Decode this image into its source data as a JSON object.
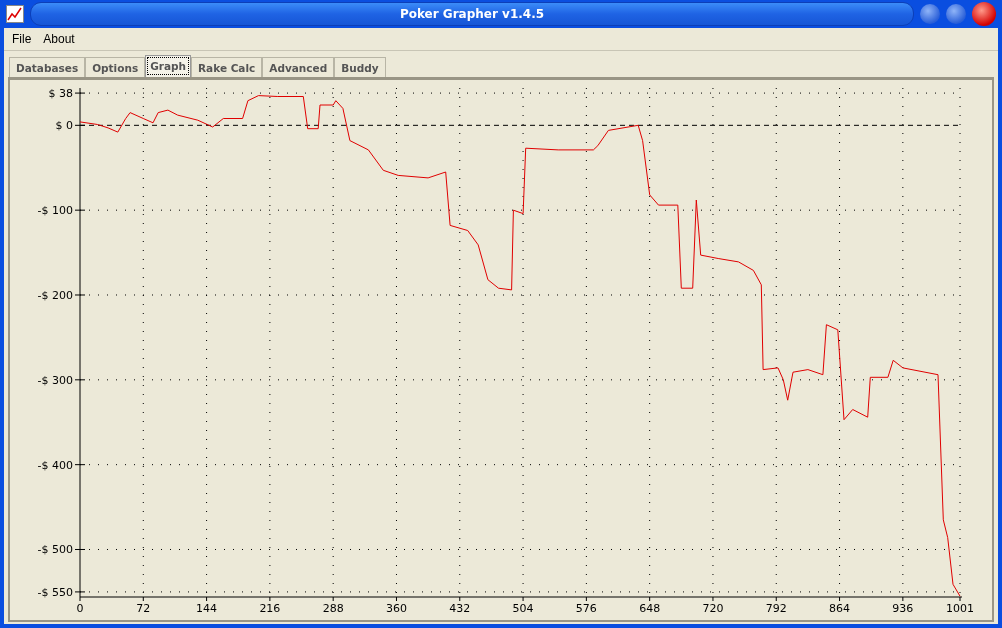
{
  "window": {
    "title": "Poker Grapher v1.4.5"
  },
  "menu": [
    {
      "label": "File"
    },
    {
      "label": "About"
    }
  ],
  "tabs": [
    {
      "label": "Databases",
      "selected": false
    },
    {
      "label": "Options",
      "selected": false
    },
    {
      "label": "Graph",
      "selected": true
    },
    {
      "label": "Rake Calc",
      "selected": false
    },
    {
      "label": "Advanced",
      "selected": false
    },
    {
      "label": "Buddy",
      "selected": false
    }
  ],
  "graph": {
    "chart_data": {
      "type": "line",
      "xlim": [
        0,
        1001
      ],
      "ylim": [
        -556,
        44
      ],
      "xticks": [
        0,
        72,
        144,
        216,
        288,
        360,
        432,
        504,
        576,
        648,
        720,
        792,
        864,
        936,
        1001
      ],
      "yticks": [
        {
          "value": 38,
          "label": "$ 38"
        },
        {
          "value": 0,
          "label": "$ 0"
        },
        {
          "value": -100,
          "label": "-$ 100"
        },
        {
          "value": -200,
          "label": "-$ 200"
        },
        {
          "value": -300,
          "label": "-$ 300"
        },
        {
          "value": -400,
          "label": "-$ 400"
        },
        {
          "value": -500,
          "label": "-$ 500"
        },
        {
          "value": -550,
          "label": "-$ 550"
        }
      ],
      "x": [
        0,
        20,
        32,
        43,
        52,
        57,
        72,
        83,
        89,
        100,
        111,
        134,
        151,
        163,
        185,
        191,
        203,
        225,
        254,
        259,
        271,
        273,
        288,
        291,
        299,
        307,
        328,
        345,
        362,
        396,
        416,
        421,
        441,
        453,
        464,
        476,
        491,
        493,
        504,
        507,
        544,
        584,
        589,
        601,
        635,
        640,
        648,
        658,
        680,
        684,
        697,
        701,
        706,
        726,
        749,
        766,
        775,
        777,
        794,
        800,
        805,
        811,
        828,
        845,
        849,
        862,
        869,
        879,
        896,
        899,
        919,
        925,
        936,
        976,
        982,
        987,
        993,
        1001
      ],
      "grid": true,
      "series": [
        {
          "color": "#e00000",
          "values": [
            4,
            1,
            -3,
            -8,
            8,
            15,
            8,
            3,
            15,
            18,
            12,
            6,
            -2,
            8,
            8,
            29,
            35,
            34,
            34,
            -4,
            -4,
            24,
            24,
            29,
            20,
            -18,
            -29,
            -53,
            -59,
            -62,
            -55,
            -118,
            -124,
            -141,
            -182,
            -192,
            -194,
            -100,
            -104,
            -27,
            -29,
            -29,
            -24,
            -6,
            0,
            -18,
            -82,
            -94,
            -94,
            -192,
            -192,
            -88,
            -153,
            -157,
            -161,
            -171,
            -188,
            -288,
            -286,
            -300,
            -324,
            -291,
            -288,
            -294,
            -235,
            -241,
            -347,
            -335,
            -344,
            -297,
            -297,
            -277,
            -286,
            -294,
            -465,
            -486,
            -541,
            -555
          ]
        }
      ]
    }
  }
}
